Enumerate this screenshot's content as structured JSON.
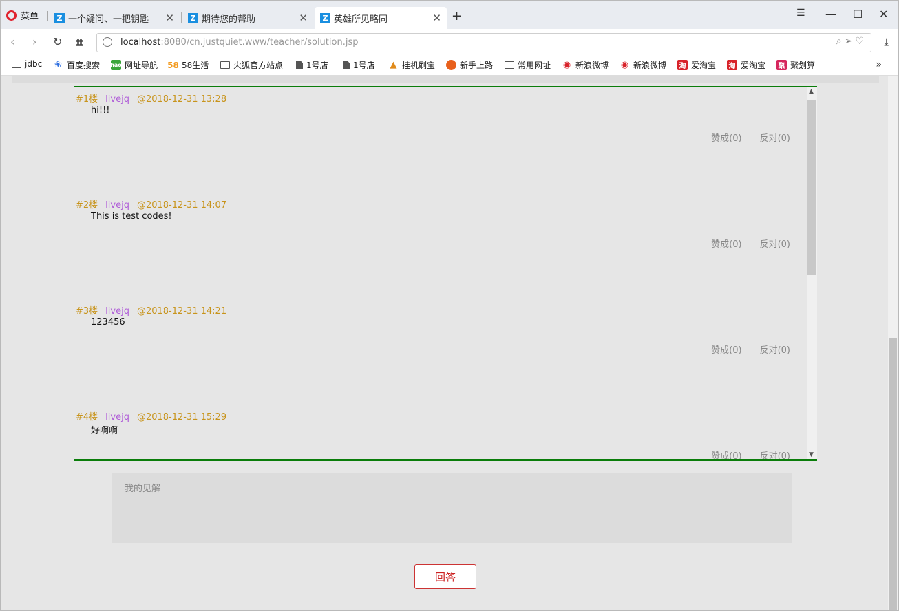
{
  "browser": {
    "menu_label": "菜单",
    "tabs": [
      {
        "title": "一个疑问、一把钥匙",
        "favicon": "Z"
      },
      {
        "title": "期待您的帮助",
        "favicon": "Z"
      },
      {
        "title": "英雄所见略同",
        "favicon": "Z"
      }
    ],
    "new_tab": "+",
    "url_host": "localhost",
    "url_rest": ":8080/cn.justquiet.www/teacher/solution.jsp"
  },
  "bookmarks": [
    {
      "label": "jdbc",
      "icon": "folder-icon"
    },
    {
      "label": "百度搜索",
      "icon": "baidu-icon"
    },
    {
      "label": "网址导航",
      "icon": "hao-icon"
    },
    {
      "label": "58生活",
      "icon": "58-icon"
    },
    {
      "label": "火狐官方站点",
      "icon": "folder-icon"
    },
    {
      "label": "1号店",
      "icon": "document-icon"
    },
    {
      "label": "1号店",
      "icon": "document-icon"
    },
    {
      "label": "挂机刷宝",
      "icon": "pma-icon"
    },
    {
      "label": "新手上路",
      "icon": "firefox-icon"
    },
    {
      "label": "常用网址",
      "icon": "folder-icon"
    },
    {
      "label": "新浪微博",
      "icon": "weibo-icon"
    },
    {
      "label": "新浪微博",
      "icon": "weibo-icon"
    },
    {
      "label": "爱淘宝",
      "icon": "taobao-icon"
    },
    {
      "label": "爱淘宝",
      "icon": "taobao-icon"
    },
    {
      "label": "聚划算",
      "icon": "juhuasuan-icon"
    }
  ],
  "answers": [
    {
      "floor": "#1楼",
      "user": "livejq",
      "time": "@2018-12-31 13:28",
      "text": "hi!!!",
      "agree": "赞成(0)",
      "oppose": "反对(0)"
    },
    {
      "floor": "#2楼",
      "user": "livejq",
      "time": "@2018-12-31 14:07",
      "text": "This is test codes!",
      "agree": "赞成(0)",
      "oppose": "反对(0)"
    },
    {
      "floor": "#3楼",
      "user": "livejq",
      "time": "@2018-12-31 14:21",
      "text": "123456",
      "agree": "赞成(0)",
      "oppose": "反对(0)"
    },
    {
      "floor": "#4楼",
      "user": "livejq",
      "time": "@2018-12-31 15:29",
      "text": "好啊啊",
      "agree": "赞成(0)",
      "oppose": "反对(0)"
    }
  ],
  "reply": {
    "placeholder": "我的见解",
    "submit_label": "回答"
  },
  "colors": {
    "accent_green": "#0a7d0a",
    "floor_color": "#c8941c",
    "user_color": "#b05fd8",
    "submit_red": "#cc2222"
  }
}
